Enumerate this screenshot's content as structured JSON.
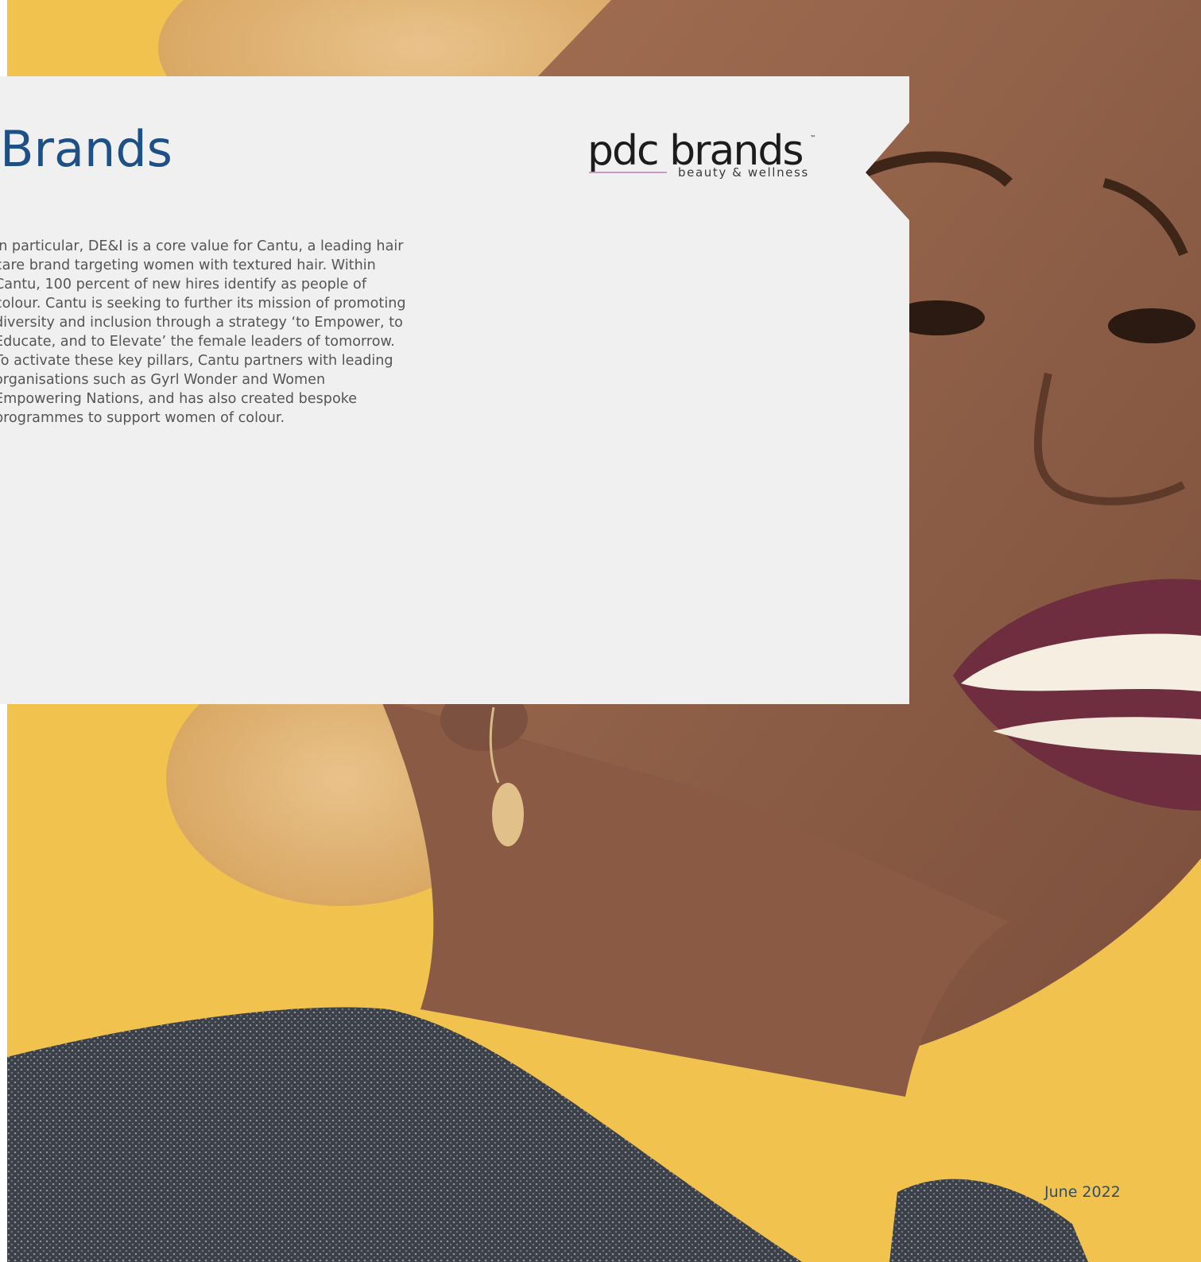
{
  "page": {
    "title": "Brands",
    "body": "In particular, DE&I is a core value for Cantu, a leading hair care brand targeting women with textured hair. Within Cantu, 100 percent of new hires identify as people of colour. Cantu is seeking to further its mission of promoting diversity and inclusion through a strategy ‘to Empower, to Educate, and to Elevate’ the female leaders of tomorrow. To activate these key pillars, Cantu partners with leading organisations such as Gyrl Wonder and Women Empowering Nations, and has also created bespoke programmes to support women of colour.",
    "date": "June 2022"
  },
  "logo": {
    "name": "pdc brands",
    "trademark": "™",
    "tagline": "beauty & wellness"
  },
  "colors": {
    "title": "#1d5087",
    "body": "#555555",
    "card_background": "#f0f0f0",
    "photo_background": "#f2c24e",
    "date": "#2e4e6b",
    "logo_accent": "#c89ac4"
  }
}
